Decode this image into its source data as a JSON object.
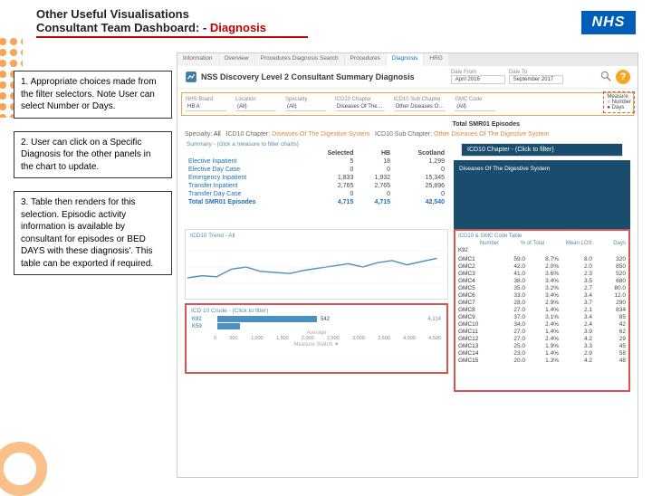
{
  "title_line1": "Other Useful Visualisations",
  "title_line2a": "Consultant Team Dashboard: - ",
  "title_line2b": "Diagnosis",
  "nhs": "NHS",
  "notes": {
    "n1": "1. Appropriate choices made from the filter selectors. Note User can select Number or Days.",
    "n2": "2. User can click on a Specific Diagnosis for the other panels in the chart to update.",
    "n3": "3. Table then renders for this selection. Episodic activity information is available by consultant for episodes or BED DAYS with these diagnosis'. This table can be exported if required."
  },
  "tabs": [
    "Information",
    "Overview",
    "Procedures Diagnosis Search",
    "Procedures",
    "Diagnosis",
    "HRG"
  ],
  "active_tab": "Diagnosis",
  "dash_title": "NSS Discovery Level 2 Consultant Summary Diagnosis",
  "date_from_lbl": "Date From",
  "date_from": "April 2016",
  "date_to_lbl": "Date To",
  "date_to": "September 2017",
  "filters": [
    {
      "lbl": "NHS Board",
      "val": "HB A"
    },
    {
      "lbl": "Location",
      "val": "(All)"
    },
    {
      "lbl": "Specialty",
      "val": "(All)"
    },
    {
      "lbl": "ICD10 Chapter",
      "val": "Diseases Of The…"
    },
    {
      "lbl": "ICD10 Sub Chapter",
      "val": "Other Diseases O…"
    },
    {
      "lbl": "GMC Code",
      "val": "(All)"
    }
  ],
  "measure": {
    "lbl": "Measure",
    "v1": "Number",
    "v2": "Days"
  },
  "crumb_total": "Total SMR01 Episodes",
  "crumb": "Specialty: All   ICD10 Chapter: Diseases Of The Digestive System   ICD10 Sub Chapter: Other Diseases Of The Digestive System",
  "summary_lbl": "Summary - (click a measure to filter charts)",
  "right_head_lbl": "ICD10 Chapter - (Click to filter)",
  "right_head_val": "Diseases Of The Digestive System",
  "table": {
    "head": [
      "",
      "Selected",
      "HB",
      "Scotland"
    ],
    "rows": [
      [
        "Elective Inpatient",
        "5",
        "18",
        "1,299"
      ],
      [
        "Elective Day Case",
        "0",
        "0",
        "0"
      ],
      [
        "Emergency Inpatient",
        "1,833",
        "1,932",
        "15,345"
      ],
      [
        "Transfer Inpatient",
        "2,765",
        "2,765",
        "25,896"
      ],
      [
        "Transfer Day Case",
        "0",
        "0",
        "0"
      ]
    ],
    "total": [
      "Total SMR01 Episodes",
      "4,715",
      "4,715",
      "42,540"
    ]
  },
  "trend_title": "ICD10 Trend - All",
  "crude_title": "ICD 10 Crude - (Click to filter)",
  "crude": {
    "rows": [
      {
        "lbl": "K92",
        "val": 542,
        "pct": 40
      },
      {
        "lbl": "K59",
        "val": 120,
        "pct": 9
      }
    ],
    "marker": "4,114",
    "ticks": [
      "0",
      "500",
      "1,000",
      "1,500",
      "2,000",
      "2,500",
      "3,000",
      "3,500",
      "4,000",
      "4,500"
    ],
    "switch": "Measure Switch ▼",
    "avg": "Average"
  },
  "gmc_title": "ICD10 & GMC Code Table",
  "gmc_head": [
    "",
    "Number",
    "% of Total",
    "Mean LOS",
    "Days"
  ],
  "gmc": [
    [
      "GMC1",
      "59.0",
      "8.7%",
      "8.0",
      "320"
    ],
    [
      "GMC2",
      "42.0",
      "2.0%",
      "2.0",
      "850"
    ],
    [
      "GMC3",
      "41.0",
      "3.6%",
      "2.3",
      "520"
    ],
    [
      "GMC4",
      "38.0",
      "3.4%",
      "3.5",
      "680"
    ],
    [
      "GMC5",
      "35.0",
      "3.2%",
      "2.7",
      "80.0"
    ],
    [
      "GMC6",
      "33.0",
      "3.4%",
      "3.4",
      "12.0"
    ],
    [
      "GMC7",
      "28.0",
      "2.9%",
      "3.7",
      "290"
    ],
    [
      "GMC8",
      "27.0",
      "1.4%",
      "2.1",
      "834"
    ],
    [
      "GMC9",
      "37.0",
      "3.1%",
      "3.4",
      "85"
    ],
    [
      "GMC10",
      "34.0",
      "2.4%",
      "2.4",
      "42"
    ],
    [
      "GMC11",
      "27.0",
      "1.4%",
      "3.9",
      "62"
    ],
    [
      "GMC12",
      "27.0",
      "2.4%",
      "4.2",
      "29"
    ],
    [
      "GMC13",
      "25.0",
      "1.9%",
      "3.3",
      "45"
    ],
    [
      "GMC14",
      "23.0",
      "1.4%",
      "2.9",
      "58"
    ],
    [
      "GMC15",
      "20.0",
      "1.3%",
      "4.2",
      "48"
    ]
  ],
  "k92": "K92",
  "chart_data": {
    "type": "line",
    "title": "ICD10 Trend - All",
    "series": [
      {
        "name": "trend",
        "values": [
          20,
          22,
          21,
          28,
          30,
          26,
          25,
          24,
          27,
          29,
          31,
          33,
          30,
          34,
          36,
          32,
          35,
          38
        ]
      }
    ],
    "ylim": [
      0,
      40
    ]
  }
}
